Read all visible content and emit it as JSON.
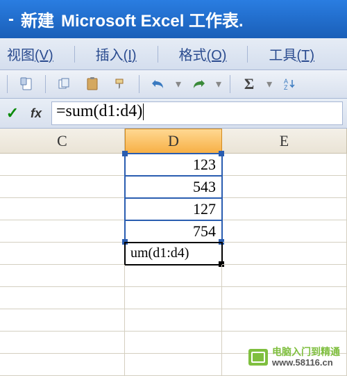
{
  "title": {
    "dash": "-",
    "newdoc": "新建",
    "app": "Microsoft Excel 工作表."
  },
  "menu": {
    "view_label": "视图",
    "view_key": "(V)",
    "insert_label": "插入",
    "insert_key": "(I)",
    "format_label": "格式",
    "format_key": "(O)",
    "tools_label": "工具",
    "tools_key": "(T)"
  },
  "formula_bar": {
    "fx": "fx",
    "formula": "=sum(d1:d4)"
  },
  "columns": {
    "c": "C",
    "d": "D",
    "e": "E"
  },
  "cells": {
    "d1": "123",
    "d2": "543",
    "d3": "127",
    "d4": "754",
    "d5": "um(d1:d4)"
  },
  "watermark": {
    "line1": "电脑入门到精通",
    "line2": "www.58116.cn"
  }
}
